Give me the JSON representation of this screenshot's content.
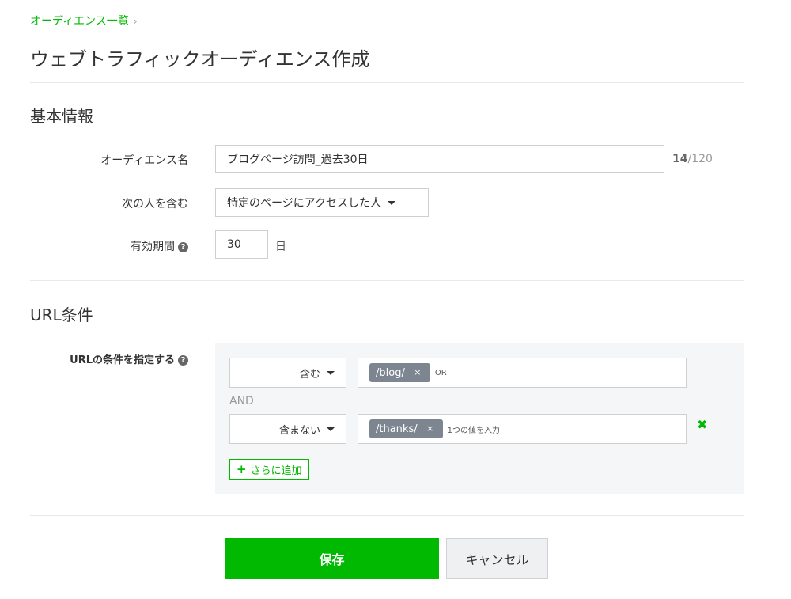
{
  "breadcrumb": {
    "label": "オーディエンス一覧",
    "chevron": "›"
  },
  "page_title": "ウェブトラフィックオーディエンス作成",
  "basic_info": {
    "title": "基本情報",
    "audience_name": {
      "label": "オーディエンス名",
      "value": "ブログページ訪問_過去30日",
      "count": "14",
      "max": "/120"
    },
    "include": {
      "label": "次の人を含む",
      "value": "特定のページにアクセスした人"
    },
    "validity": {
      "label": "有効期間",
      "help_icon": "?",
      "value": "30",
      "unit": "日"
    }
  },
  "url_conditions": {
    "title": "URL条件",
    "label": "URLの条件を指定する",
    "help_icon": "?",
    "rows": [
      {
        "operator": "含む",
        "tag": "/blog/",
        "tag_remove": "×",
        "input_hint": "OR"
      },
      {
        "operator": "含まない",
        "tag": "/thanks/",
        "tag_remove": "×",
        "input_hint": "1つの値を入力",
        "remove_icon": "✖"
      }
    ],
    "joiner": "AND",
    "add_button": {
      "plus": "+",
      "label": "さらに追加"
    }
  },
  "actions": {
    "save": "保存",
    "cancel": "キャンセル"
  },
  "colors": {
    "accent": "#00b900",
    "tag_bg": "#7d8591",
    "panel_bg": "#f5f6f7"
  }
}
